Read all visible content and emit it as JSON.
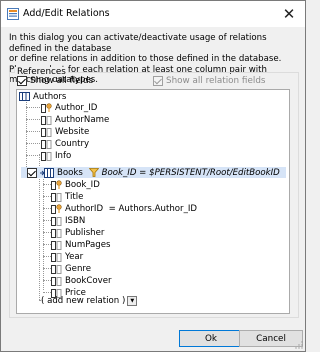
{
  "window": {
    "title": "Add/Edit Relations"
  },
  "description": {
    "line1": "In this dialog you can activate/deactivate usage of relations defined in the database",
    "line2": "or define relations in addition to those defined in the database.",
    "line3": "Please select for each relation at least one column pair with matching datatypes."
  },
  "references": {
    "group_label": "References",
    "show_all_fields": {
      "label": "Show all fields",
      "checked": true
    },
    "show_all_relation_fields": {
      "label": "Show all relation fields",
      "checked": true,
      "enabled": false
    }
  },
  "tree": {
    "root": "Authors",
    "root_children": [
      "Author_ID",
      "AuthorName",
      "Website",
      "Country",
      "Info"
    ],
    "books": {
      "label": "Books",
      "expression": "Book_ID = $PERSISTENT/Root/EditBookID",
      "checked": true
    },
    "book_fields": [
      {
        "name": "Book_ID",
        "icon": "key"
      },
      {
        "name": "Title",
        "icon": "field"
      },
      {
        "name": "AuthorID",
        "icon": "key",
        "relation": "= Authors.Author_ID"
      },
      {
        "name": "ISBN",
        "icon": "field"
      },
      {
        "name": "Publisher",
        "icon": "field"
      },
      {
        "name": "NumPages",
        "icon": "field"
      },
      {
        "name": "Year",
        "icon": "field"
      },
      {
        "name": "Genre",
        "icon": "field"
      },
      {
        "name": "BookCover",
        "icon": "field"
      },
      {
        "name": "Price",
        "icon": "field"
      }
    ],
    "add_new_relation": "( add new relation )"
  },
  "buttons": {
    "ok": "Ok",
    "cancel": "Cancel"
  },
  "colors": {
    "selection": "#d6e4f7",
    "primary_border": "#0078d7"
  }
}
